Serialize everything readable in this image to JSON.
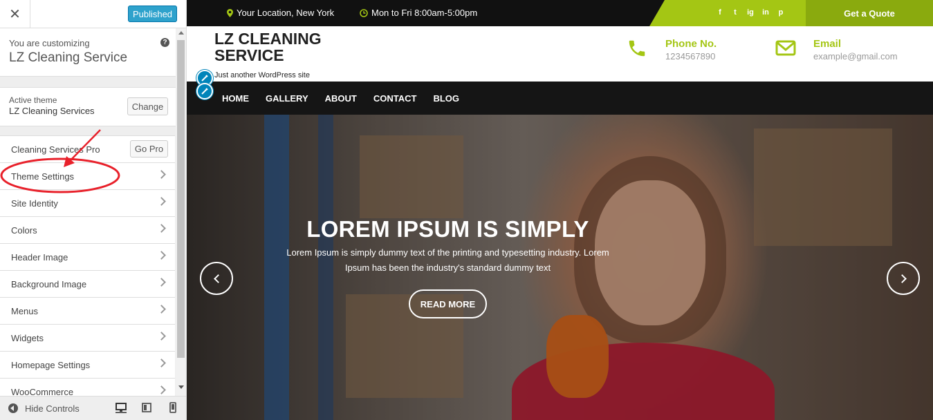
{
  "customizer": {
    "publish_label": "Published",
    "customizing_label": "You are customizing",
    "site_name": "LZ Cleaning Service",
    "active_theme_label": "Active theme",
    "active_theme_name": "LZ Cleaning Services",
    "change_label": "Change",
    "pro_item": {
      "label": "Cleaning Services Pro",
      "button": "Go Pro"
    },
    "items": [
      {
        "label": "Theme Settings"
      },
      {
        "label": "Site Identity"
      },
      {
        "label": "Colors"
      },
      {
        "label": "Header Image"
      },
      {
        "label": "Background Image"
      },
      {
        "label": "Menus"
      },
      {
        "label": "Widgets"
      },
      {
        "label": "Homepage Settings"
      },
      {
        "label": "WooCommerce"
      }
    ],
    "hide_controls_label": "Hide Controls"
  },
  "site": {
    "topbar": {
      "location": "Your Location, New York",
      "hours": "Mon to Fri 8:00am-5:00pm",
      "social": [
        "f",
        "t",
        "ig",
        "in",
        "p"
      ],
      "quote_label": "Get a Quote"
    },
    "title": "LZ CLEANING SERVICE",
    "tagline": "Just another WordPress site",
    "phone": {
      "label": "Phone No.",
      "value": "1234567890"
    },
    "email": {
      "label": "Email",
      "value": "example@gmail.com"
    },
    "nav": [
      "HOME",
      "GALLERY",
      "ABOUT",
      "CONTACT",
      "BLOG"
    ],
    "hero": {
      "title": "LOREM IPSUM IS SIMPLY",
      "text": "Lorem Ipsum is simply dummy text of the printing and typesetting industry. Lorem Ipsum has been the industry's standard dummy text",
      "button": "READ MORE"
    }
  },
  "colors": {
    "accent_green": "#a4c614",
    "publish_blue": "#2ea2cc",
    "annotation_red": "#e8202a"
  }
}
